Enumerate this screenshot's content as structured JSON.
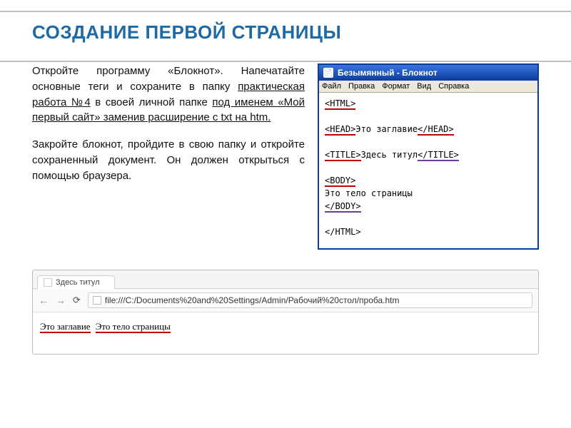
{
  "title": "СОЗДАНИЕ ПЕРВОЙ СТРАНИЦЫ",
  "instructions": {
    "p1_a": "Откройте программу «Блокнот». Напечатайте основные теги и сохраните в папку ",
    "p1_u1": "практическая работа №4",
    "p1_b": " в своей личной папке ",
    "p1_u2": "под именем «Мой первый сайт» заменив расширение с txt на  htm.",
    "p2": "Закройте блокнот, пройдите в свою папку и откройте сохраненный документ. Он должен открыться с помощью браузера."
  },
  "notepad": {
    "window_title": "Безымянный - Блокнот",
    "menu": [
      "Файл",
      "Правка",
      "Формат",
      "Вид",
      "Справка"
    ],
    "lines": [
      {
        "text": "<HTML>",
        "cls": "red-ul"
      },
      {
        "text": "",
        "cls": ""
      },
      {
        "text_a": "<HEAD>",
        "text_b": "Это заглавие",
        "text_c": "</HEAD>",
        "mode": "head"
      },
      {
        "text": "",
        "cls": ""
      },
      {
        "text_a": "<TITLE>",
        "text_b": "Здесь титул",
        "text_c": "</TITLE>",
        "mode": "title"
      },
      {
        "text": "",
        "cls": ""
      },
      {
        "text": "<BODY>",
        "cls": "red-ul",
        "mode": "body-open"
      },
      {
        "text": "Это тело страницы",
        "cls": ""
      },
      {
        "text": "</BODY>",
        "cls": "purple-ul"
      },
      {
        "text": "",
        "cls": ""
      },
      {
        "text": "</HTML>",
        "cls": ""
      }
    ]
  },
  "browser": {
    "tab_title": "Здесь титул",
    "url": "file:///C:/Documents%20and%20Settings/Admin/Рабочий%20стол/проба.htm",
    "content_a": "Это заглавие",
    "content_b": "Это тело страницы"
  }
}
